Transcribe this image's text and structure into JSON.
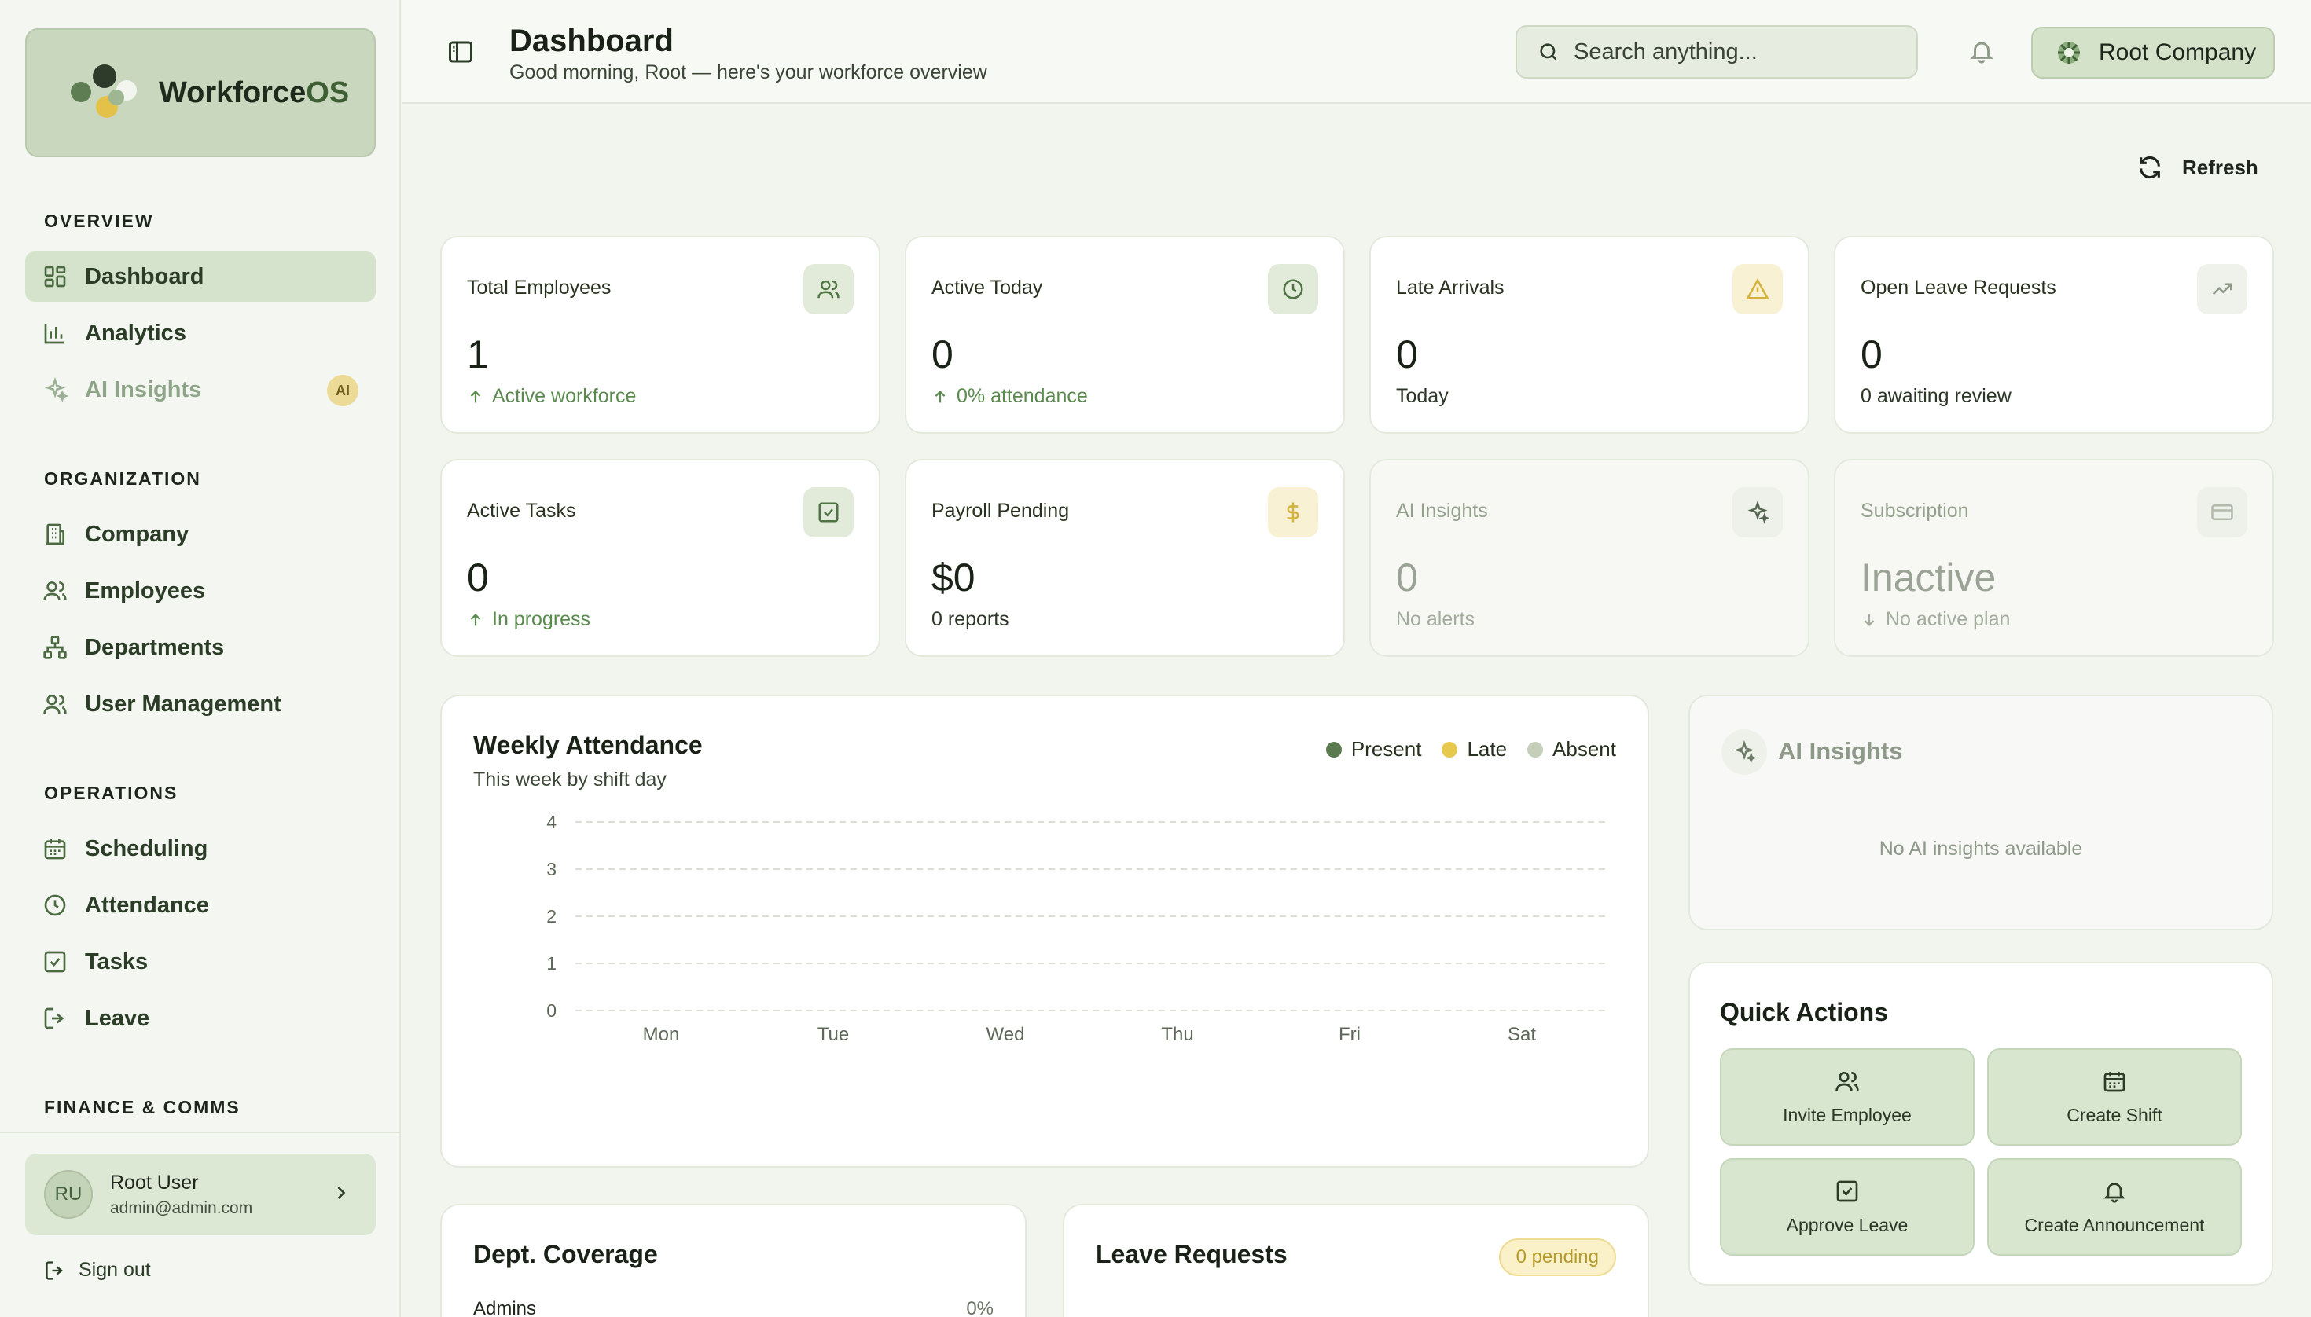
{
  "app": {
    "brand_main": "Workforce",
    "brand_accent": "OS"
  },
  "sidebar": {
    "sections": [
      {
        "title": "OVERVIEW",
        "items": [
          {
            "label": "Dashboard",
            "icon": "grid-icon",
            "active": true
          },
          {
            "label": "Analytics",
            "icon": "bar-chart-icon"
          },
          {
            "label": "AI Insights",
            "icon": "sparkle-icon",
            "badge": "AI",
            "dim": true
          }
        ]
      },
      {
        "title": "ORGANIZATION",
        "items": [
          {
            "label": "Company",
            "icon": "building-icon"
          },
          {
            "label": "Employees",
            "icon": "users-icon"
          },
          {
            "label": "Departments",
            "icon": "network-icon"
          },
          {
            "label": "User Management",
            "icon": "user-management-icon"
          }
        ]
      },
      {
        "title": "OPERATIONS",
        "items": [
          {
            "label": "Scheduling",
            "icon": "calendar-icon"
          },
          {
            "label": "Attendance",
            "icon": "clock-icon"
          },
          {
            "label": "Tasks",
            "icon": "checkbox-icon"
          },
          {
            "label": "Leave",
            "icon": "logout-icon"
          }
        ]
      },
      {
        "title": "FINANCE & COMMS",
        "items": []
      }
    ],
    "user": {
      "initials": "RU",
      "name": "Root User",
      "email": "admin@admin.com"
    },
    "signout_label": "Sign out"
  },
  "header": {
    "title": "Dashboard",
    "subtitle": "Good morning, Root — here's your workforce overview",
    "search_placeholder": "Search anything...",
    "company": "Root Company"
  },
  "toolbar": {
    "refresh_label": "Refresh"
  },
  "stats": [
    {
      "label": "Total Employees",
      "value": "1",
      "sub": "Active workforce",
      "trend": "up",
      "icon": "users-icon"
    },
    {
      "label": "Active Today",
      "value": "0",
      "sub": "0% attendance",
      "trend": "up",
      "icon": "clock-icon"
    },
    {
      "label": "Late Arrivals",
      "value": "0",
      "sub": "Today",
      "trend": "none",
      "icon": "warning-icon"
    },
    {
      "label": "Open Leave Requests",
      "value": "0",
      "sub": "0 awaiting review",
      "trend": "none",
      "icon": "trending-up-icon"
    },
    {
      "label": "Active Tasks",
      "value": "0",
      "sub": "In progress",
      "trend": "up",
      "icon": "checkbox-icon"
    },
    {
      "label": "Payroll Pending",
      "value": "$0",
      "sub": "0 reports",
      "trend": "none",
      "icon": "dollar-icon"
    },
    {
      "label": "AI Insights",
      "value": "0",
      "sub": "No alerts",
      "trend": "none",
      "icon": "sparkle-icon",
      "muted": true
    },
    {
      "label": "Subscription",
      "value": "Inactive",
      "sub": "No active plan",
      "trend": "down",
      "icon": "card-icon",
      "muted": true
    }
  ],
  "attendance": {
    "title": "Weekly Attendance",
    "subtitle": "This week by shift day",
    "legend": [
      "Present",
      "Late",
      "Absent"
    ]
  },
  "chart_data": {
    "type": "bar",
    "title": "Weekly Attendance",
    "subtitle": "This week by shift day",
    "categories": [
      "Mon",
      "Tue",
      "Wed",
      "Thu",
      "Fri",
      "Sat"
    ],
    "series": [
      {
        "name": "Present",
        "color": "#5b7a4f",
        "values": [
          0,
          0,
          0,
          0,
          0,
          0
        ]
      },
      {
        "name": "Late",
        "color": "#e6c84f",
        "values": [
          0,
          0,
          0,
          0,
          0,
          0
        ]
      },
      {
        "name": "Absent",
        "color": "#c4ceb8",
        "values": [
          0,
          0,
          0,
          0,
          0,
          0
        ]
      }
    ],
    "ylim": [
      0,
      4
    ],
    "yticks": [
      0,
      1,
      2,
      3,
      4
    ],
    "grid": true,
    "legend": "top-right"
  },
  "ai_panel": {
    "title": "AI Insights",
    "empty": "No AI insights available"
  },
  "quick_actions": {
    "title": "Quick Actions",
    "items": [
      {
        "label": "Invite Employee",
        "icon": "users-icon"
      },
      {
        "label": "Create Shift",
        "icon": "calendar-icon"
      },
      {
        "label": "Approve Leave",
        "icon": "checkbox-icon"
      },
      {
        "label": "Create Announcement",
        "icon": "bell-icon"
      }
    ]
  },
  "dept_coverage": {
    "title": "Dept. Coverage",
    "rows": [
      {
        "name": "Admins",
        "value": "0%"
      }
    ]
  },
  "leave_requests": {
    "title": "Leave Requests",
    "badge": "0 pending"
  },
  "colors": {
    "accent": "#5a8a4e",
    "brand": "#c8d7bd",
    "warning": "#e6c84f",
    "background": "#f2f5ee"
  }
}
